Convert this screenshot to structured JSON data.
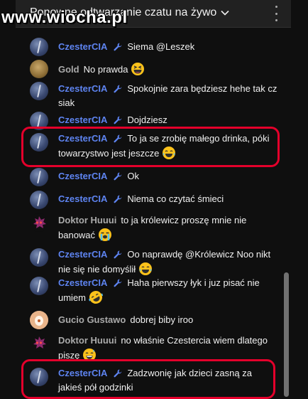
{
  "header": {
    "title": "Ponowne odtwarzanie czatu na żywo",
    "menu_icon": "more-vert-icon",
    "chevron_icon": "chevron-down-icon"
  },
  "watermark": "www.wiocha.pl",
  "colors": {
    "moderator_name": "#5e84f1",
    "regular_name": "#aaaaaa",
    "highlight": "#e4002b",
    "background": "#0f0f0f"
  },
  "messages": [
    {
      "author": "CzesterCIA",
      "moderator": true,
      "text": "Siema @Leszek",
      "emoji": ""
    },
    {
      "author": "Gold",
      "moderator": false,
      "text": "No prawda",
      "emoji": "grinning-squint-face"
    },
    {
      "author": "CzesterCIA",
      "moderator": true,
      "text": "Spokojnie zara będziesz hehe tak cz siak",
      "emoji": ""
    },
    {
      "author": "CzesterCIA",
      "moderator": true,
      "text": "Dojdziesz",
      "emoji": ""
    },
    {
      "author": "CzesterCIA",
      "moderator": true,
      "text": "To ja se zrobię małego drinka, póki towarzystwo jest jeszcze",
      "emoji": "tears-of-joy-face",
      "highlighted": true
    },
    {
      "author": "CzesterCIA",
      "moderator": true,
      "text": "Ok",
      "emoji": ""
    },
    {
      "author": "CzesterCIA",
      "moderator": true,
      "text": "Niema co czytać śmieci",
      "emoji": ""
    },
    {
      "author": "Doktor Huuui",
      "moderator": false,
      "text": "to ja królewicz proszę mnie nie banować",
      "emoji": "loudly-crying-face"
    },
    {
      "author": "CzesterCIA",
      "moderator": true,
      "text": "Oo naprawdę @Królewicz Noo nikt nie się nie domyślił",
      "emoji": "tears-of-joy-face"
    },
    {
      "author": "CzesterCIA",
      "moderator": true,
      "text": "Haha pierwszy łyk i juz pisać nie umiem",
      "emoji": "rolling-laughing-face"
    },
    {
      "author": "Gucio Gustawo",
      "moderator": false,
      "text": "dobrej biby iroo",
      "emoji": ""
    },
    {
      "author": "Doktor Huuui",
      "moderator": false,
      "text": "no właśnie Czestercia wiem dlatego piszę",
      "emoji": "smiling-sweat-face"
    },
    {
      "author": "CzesterCIA",
      "moderator": true,
      "text": "Zadzwonię jak dzieci zasną za jakieś pół godzinki",
      "emoji": "",
      "highlighted": true
    }
  ]
}
